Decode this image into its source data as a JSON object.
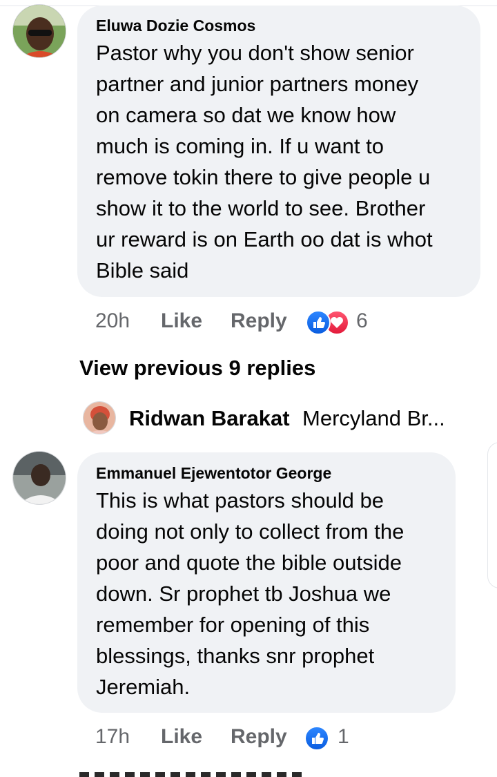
{
  "comments": [
    {
      "author": "Eluwa Dozie Cosmos",
      "text": "Pastor why you don't show senior\npartner and junior partners money\non camera so dat we know how\nmuch is coming in. If u want to\nremove tokin there to give people u\nshow it to the world to see. Brother\nur reward is on Earth oo dat is whot\nBible said",
      "time": "20h",
      "like_label": "Like",
      "reply_label": "Reply",
      "reactions": [
        "like",
        "love"
      ],
      "reaction_count": "6"
    },
    {
      "author": "Emmanuel Ejewentotor George",
      "text": "This is what pastors should be\ndoing not only to collect from the\npoor and quote the bible outside\ndown. Sr prophet tb Joshua we\nremember for opening of this\nblessings, thanks snr prophet\nJeremiah.",
      "time": "17h",
      "like_label": "Like",
      "reply_label": "Reply",
      "reactions": [
        "like"
      ],
      "reaction_count": "1"
    }
  ],
  "view_previous": "View previous 9 replies",
  "reply_preview": {
    "name": "Ridwan Barakat",
    "snippet": "Mercyland Br..."
  },
  "colors": {
    "bubble": "#f0f2f5",
    "meta": "#65676b",
    "like": "#1877f2",
    "love": "#f33e58"
  }
}
